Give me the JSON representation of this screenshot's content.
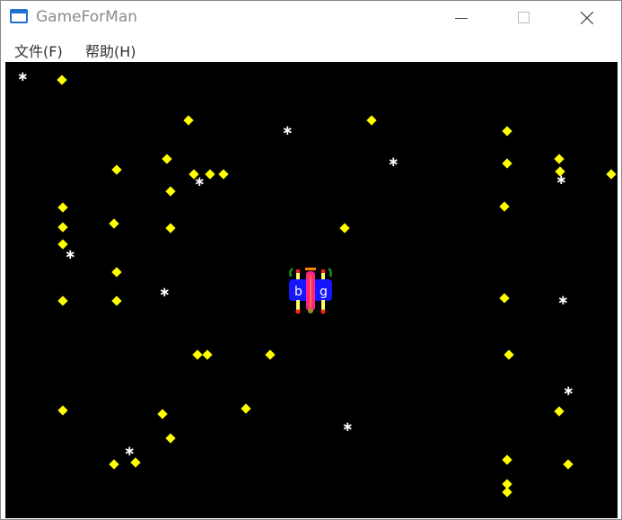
{
  "window": {
    "title": "GameForMan",
    "controls": {
      "minimize": "minimize",
      "maximize": "maximize",
      "close": "close"
    }
  },
  "menu": {
    "items": [
      {
        "label": "文件(F)"
      },
      {
        "label": "帮助(H)"
      }
    ]
  },
  "game": {
    "background": "#000000",
    "item_color": "#ffff00",
    "star_color": "#ffffff",
    "player_icon": "vehicle-sprite"
  }
}
